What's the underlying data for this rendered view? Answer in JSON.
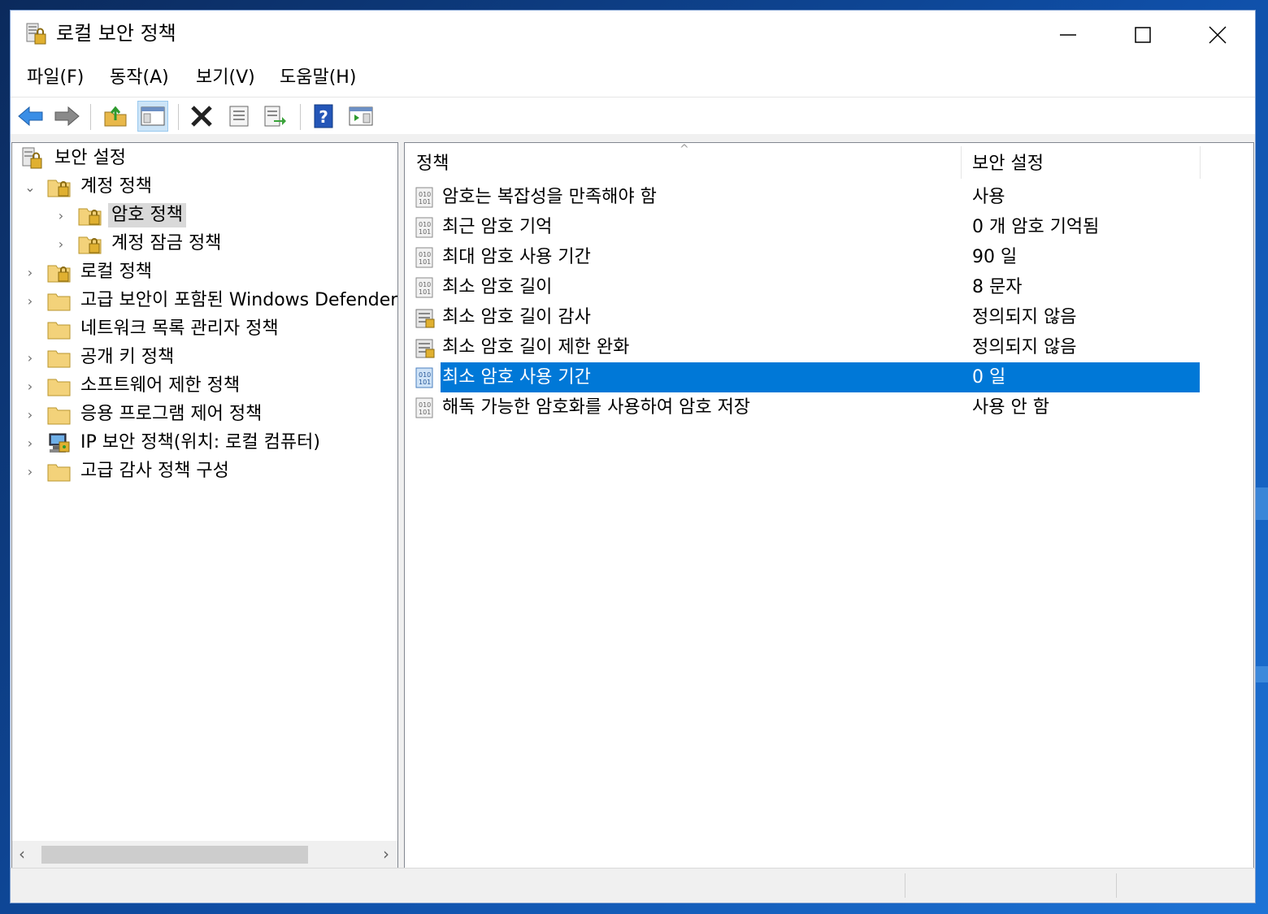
{
  "window": {
    "title": "로컬 보안 정책"
  },
  "menu": [
    "파일(F)",
    "동작(A)",
    "보기(V)",
    "도움말(H)"
  ],
  "toolbar": {
    "buttons": [
      "back-icon",
      "forward-icon",
      "up-folder-icon",
      "show-hide-tree-icon",
      "delete-icon",
      "properties-icon",
      "export-list-icon",
      "help-icon",
      "show-action-pane-icon"
    ]
  },
  "tree": {
    "root": "보안 설정",
    "items": [
      {
        "label": "계정 정책",
        "expanded": true
      },
      {
        "label": "암호 정책",
        "selected": true
      },
      {
        "label": "계정 잠금 정책"
      },
      {
        "label": "로컬 정책"
      },
      {
        "label": "고급 보안이 포함된 Windows Defender 방화벽"
      },
      {
        "label": "네트워크 목록 관리자 정책"
      },
      {
        "label": "공개 키 정책"
      },
      {
        "label": "소프트웨어 제한 정책"
      },
      {
        "label": "응용 프로그램 제어 정책"
      },
      {
        "label": "IP 보안 정책(위치: 로컬 컴퓨터)"
      },
      {
        "label": "고급 감사 정책 구성"
      }
    ]
  },
  "list": {
    "columns": [
      "정책",
      "보안 설정"
    ],
    "rows": [
      {
        "policy": "암호는 복잡성을 만족해야 함",
        "setting": "사용"
      },
      {
        "policy": "최근 암호 기억",
        "setting": "0 개 암호 기억됨"
      },
      {
        "policy": "최대 암호 사용 기간",
        "setting": "90 일"
      },
      {
        "policy": "최소 암호 길이",
        "setting": "8 문자"
      },
      {
        "policy": "최소 암호 길이 감사",
        "setting": "정의되지 않음"
      },
      {
        "policy": "최소 암호 길이 제한 완화",
        "setting": "정의되지 않음"
      },
      {
        "policy": "최소 암호 사용 기간",
        "setting": "0 일",
        "selected": true
      },
      {
        "policy": "해독 가능한 암호화를 사용하여 암호 저장",
        "setting": "사용 안 함"
      }
    ]
  },
  "colors": {
    "selection": "#0078d7",
    "folder": "#f3d27a"
  }
}
